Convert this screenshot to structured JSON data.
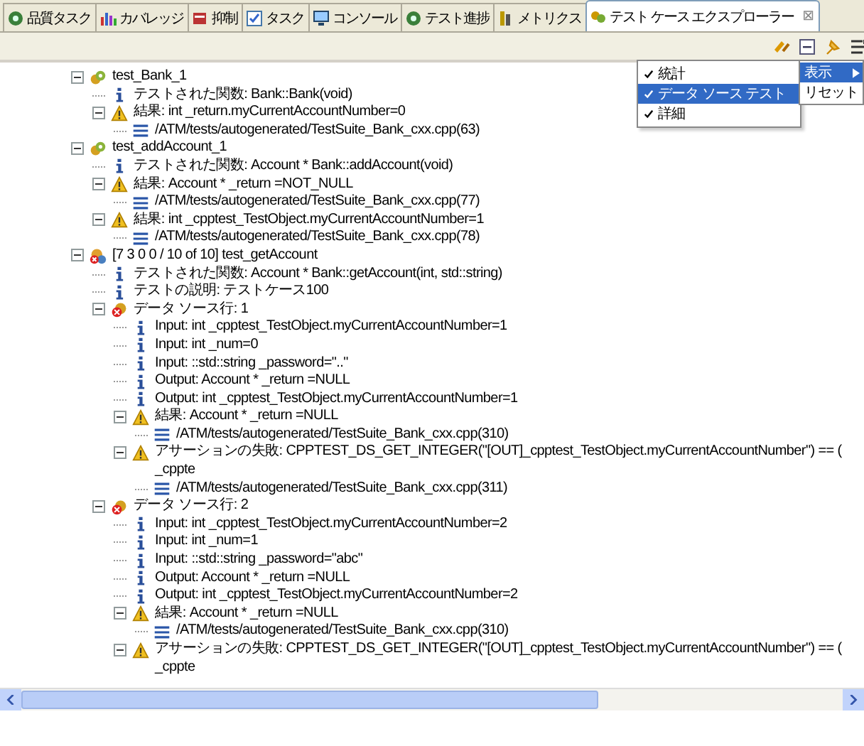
{
  "tabs": [
    {
      "label": "品質タスク",
      "selected": false
    },
    {
      "label": "カバレッジ",
      "selected": false
    },
    {
      "label": "抑制",
      "selected": false
    },
    {
      "label": "タスク",
      "selected": false
    },
    {
      "label": "コンソール",
      "selected": false
    },
    {
      "label": "テスト進捗",
      "selected": false
    },
    {
      "label": "メトリクス",
      "selected": false
    },
    {
      "label": "テスト ケース エクスプローラー",
      "selected": true,
      "close": "⊠"
    }
  ],
  "tree": [
    {
      "kind": "test",
      "label": "test_Bank_1",
      "expanded": true,
      "children": [
        {
          "kind": "info",
          "label": "テストされた関数: Bank::Bank(void)"
        },
        {
          "kind": "warning",
          "label": "結果: int _return.myCurrentAccountNumber=0",
          "expanded": true,
          "children": [
            {
              "kind": "file",
              "label": "/ATM/tests/autogenerated/TestSuite_Bank_cxx.cpp(63)"
            }
          ]
        }
      ]
    },
    {
      "kind": "test",
      "label": "test_addAccount_1",
      "expanded": true,
      "children": [
        {
          "kind": "info",
          "label": "テストされた関数: Account * Bank::addAccount(void)"
        },
        {
          "kind": "warning",
          "label": "結果: Account * _return =NOT_NULL",
          "expanded": true,
          "children": [
            {
              "kind": "file",
              "label": "/ATM/tests/autogenerated/TestSuite_Bank_cxx.cpp(77)"
            }
          ]
        },
        {
          "kind": "warning",
          "label": "結果: int _cpptest_TestObject.myCurrentAccountNumber=1",
          "expanded": true,
          "children": [
            {
              "kind": "file",
              "label": "/ATM/tests/autogenerated/TestSuite_Bank_cxx.cpp(78)"
            }
          ]
        }
      ]
    },
    {
      "kind": "failed-test",
      "label": "[7 3 0 0 / 10 of 10] test_getAccount",
      "expanded": true,
      "children": [
        {
          "kind": "info",
          "label": "テストされた関数: Account * Bank::getAccount(int, std::string)"
        },
        {
          "kind": "info",
          "label": "テストの説明: テストケース100"
        },
        {
          "kind": "failed-row",
          "label": "データ ソース行: 1",
          "expanded": true,
          "children": [
            {
              "kind": "info",
              "label": "Input: int _cpptest_TestObject.myCurrentAccountNumber=1"
            },
            {
              "kind": "info",
              "label": "Input: int _num=0"
            },
            {
              "kind": "info",
              "label": "Input: ::std::string _password=\"..\""
            },
            {
              "kind": "info",
              "label": "Output: Account * _return =NULL"
            },
            {
              "kind": "info",
              "label": "Output: int _cpptest_TestObject.myCurrentAccountNumber=1"
            },
            {
              "kind": "warning",
              "label": "結果: Account * _return =NULL",
              "expanded": true,
              "children": [
                {
                  "kind": "file",
                  "label": "/ATM/tests/autogenerated/TestSuite_Bank_cxx.cpp(310)"
                }
              ]
            },
            {
              "kind": "warning",
              "label": "アサーションの失敗: CPPTEST_DS_GET_INTEGER(\"[OUT]_cpptest_TestObject.myCurrentAccountNumber\") == ( _cppte",
              "expanded": true,
              "children": [
                {
                  "kind": "file",
                  "label": "/ATM/tests/autogenerated/TestSuite_Bank_cxx.cpp(311)"
                }
              ]
            }
          ]
        },
        {
          "kind": "failed-row",
          "label": "データ ソース行: 2",
          "expanded": true,
          "children": [
            {
              "kind": "info",
              "label": "Input: int _cpptest_TestObject.myCurrentAccountNumber=2"
            },
            {
              "kind": "info",
              "label": "Input: int _num=1"
            },
            {
              "kind": "info",
              "label": "Input: ::std::string _password=\"abc\""
            },
            {
              "kind": "info",
              "label": "Output: Account * _return =NULL"
            },
            {
              "kind": "info",
              "label": "Output: int _cpptest_TestObject.myCurrentAccountNumber=2"
            },
            {
              "kind": "warning",
              "label": "結果: Account * _return =NULL",
              "expanded": true,
              "children": [
                {
                  "kind": "file",
                  "label": "/ATM/tests/autogenerated/TestSuite_Bank_cxx.cpp(310)"
                }
              ]
            },
            {
              "kind": "warning",
              "label": "アサーションの失敗: CPPTEST_DS_GET_INTEGER(\"[OUT]_cpptest_TestObject.myCurrentAccountNumber\") == ( _cppte",
              "expanded": true
            }
          ]
        }
      ]
    }
  ],
  "menu": {
    "items": [
      {
        "label": "統計",
        "checked": true,
        "selected": false
      },
      {
        "label": "データ ソース テスト",
        "checked": true,
        "selected": true
      },
      {
        "label": "詳細",
        "checked": true,
        "selected": false
      }
    ]
  },
  "submenu": {
    "items": [
      {
        "label": "表示",
        "selected": true,
        "has_submenu": true
      },
      {
        "label": "リセット",
        "selected": false,
        "has_submenu": false
      }
    ]
  }
}
